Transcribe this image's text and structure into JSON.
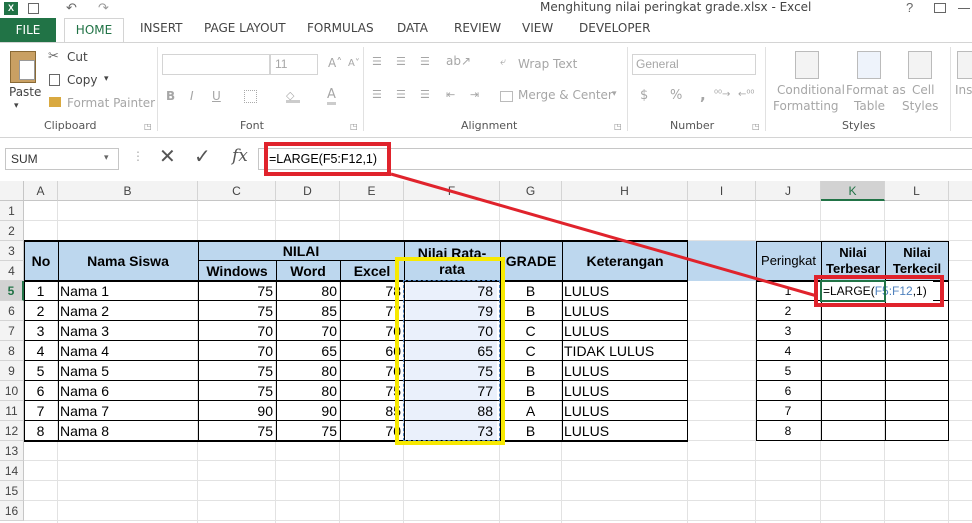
{
  "window": {
    "title": "Menghitung nilai peringkat grade.xlsx - Excel"
  },
  "tabs": [
    "FILE",
    "HOME",
    "INSERT",
    "PAGE LAYOUT",
    "FORMULAS",
    "DATA",
    "REVIEW",
    "VIEW",
    "DEVELOPER"
  ],
  "ribbon": {
    "clipboard": {
      "paste": "Paste",
      "cut": "Cut",
      "copy": "Copy",
      "format_painter": "Format Painter",
      "label": "Clipboard"
    },
    "font": {
      "name": "",
      "size": "11",
      "label": "Font",
      "bold": "B",
      "italic": "I",
      "underline": "U"
    },
    "alignment": {
      "wrap": "Wrap Text",
      "merge": "Merge & Center",
      "label": "Alignment"
    },
    "number": {
      "format": "General",
      "currency": "$",
      "percent": "%",
      "comma": ",",
      "label": "Number"
    },
    "styles": {
      "conditional": "Conditional",
      "conditional2": "Formatting",
      "format_as": "Format as",
      "table": "Table",
      "cell": "Cell",
      "styles": "Styles",
      "label": "Styles"
    },
    "insert_label": "Ins"
  },
  "formula_bar": {
    "name_box": "SUM",
    "fx": "fx",
    "formula": "=LARGE(F5:F12,1)"
  },
  "columns": [
    "A",
    "B",
    "C",
    "D",
    "E",
    "F",
    "G",
    "H",
    "I",
    "J",
    "K",
    "L"
  ],
  "rows": [
    "1",
    "2",
    "3",
    "4",
    "5",
    "6",
    "7",
    "8",
    "9",
    "10",
    "11",
    "12",
    "13",
    "14",
    "15",
    "16"
  ],
  "table": {
    "headers": {
      "no": "No",
      "nama": "Nama Siswa",
      "nilai": "NILAI",
      "windows": "Windows",
      "word": "Word",
      "excel": "Excel",
      "rata1": "Nilai Rata-",
      "rata2": "rata",
      "grade": "GRADE",
      "keterangan": "Keterangan"
    },
    "rows": [
      {
        "no": "1",
        "nama": "Nama 1",
        "windows": "75",
        "word": "80",
        "excel": "78",
        "rata": "78",
        "grade": "B",
        "ket": "LULUS"
      },
      {
        "no": "2",
        "nama": "Nama 2",
        "windows": "75",
        "word": "85",
        "excel": "77",
        "rata": "79",
        "grade": "B",
        "ket": "LULUS"
      },
      {
        "no": "3",
        "nama": "Nama 3",
        "windows": "70",
        "word": "70",
        "excel": "70",
        "rata": "70",
        "grade": "C",
        "ket": "LULUS"
      },
      {
        "no": "4",
        "nama": "Nama 4",
        "windows": "70",
        "word": "65",
        "excel": "60",
        "rata": "65",
        "grade": "C",
        "ket": "TIDAK LULUS"
      },
      {
        "no": "5",
        "nama": "Nama 5",
        "windows": "75",
        "word": "80",
        "excel": "70",
        "rata": "75",
        "grade": "B",
        "ket": "LULUS"
      },
      {
        "no": "6",
        "nama": "Nama 6",
        "windows": "75",
        "word": "80",
        "excel": "75",
        "rata": "77",
        "grade": "B",
        "ket": "LULUS"
      },
      {
        "no": "7",
        "nama": "Nama 7",
        "windows": "90",
        "word": "90",
        "excel": "85",
        "rata": "88",
        "grade": "A",
        "ket": "LULUS"
      },
      {
        "no": "8",
        "nama": "Nama 8",
        "windows": "75",
        "word": "75",
        "excel": "70",
        "rata": "73",
        "grade": "B",
        "ket": "LULUS"
      }
    ]
  },
  "rank_table": {
    "headers": {
      "peringkat": "Peringkat",
      "terbesar1": "Nilai",
      "terbesar2": "Terbesar",
      "terkecil1": "Nilai",
      "terkecil2": "Terkecil"
    },
    "ranks": [
      "1",
      "2",
      "3",
      "4",
      "5",
      "6",
      "7",
      "8"
    ],
    "edit_formula": {
      "fn": "=LARGE(",
      "ref": "F5:F12",
      "rest": ",1)"
    }
  },
  "colors": {
    "excel_green": "#217346",
    "header_fill": "#bdd7ee",
    "highlight_red": "#e0232c",
    "highlight_yellow": "#f7e900",
    "ref_blue": "#4f81bd"
  }
}
